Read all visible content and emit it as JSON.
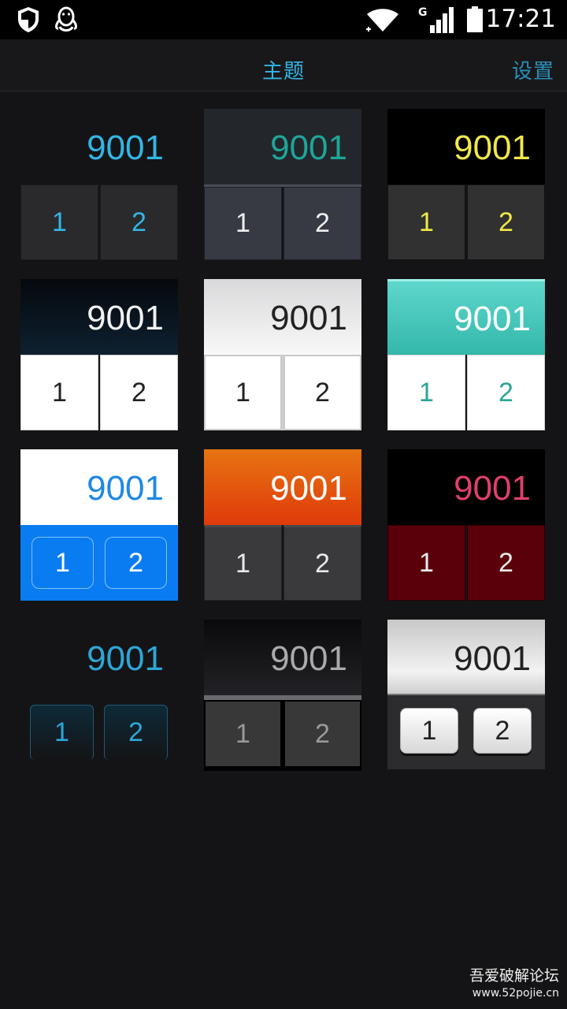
{
  "status_bar": {
    "time": "17:21",
    "network_type": "G",
    "icons": [
      "shield-icon",
      "qq-penguin-icon",
      "wifi-icon",
      "signal-icon",
      "battery-icon"
    ]
  },
  "header": {
    "title": "主题",
    "settings_label": "设置"
  },
  "themes": [
    {
      "display": "9001",
      "key1": "1",
      "key2": "2"
    },
    {
      "display": "9001",
      "key1": "1",
      "key2": "2"
    },
    {
      "display": "9001",
      "key1": "1",
      "key2": "2"
    },
    {
      "display": "9001",
      "key1": "1",
      "key2": "2"
    },
    {
      "display": "9001",
      "key1": "1",
      "key2": "2"
    },
    {
      "display": "9001",
      "key1": "1",
      "key2": "2"
    },
    {
      "display": "9001",
      "key1": "1",
      "key2": "2"
    },
    {
      "display": "9001",
      "key1": "1",
      "key2": "2"
    },
    {
      "display": "9001",
      "key1": "1",
      "key2": "2"
    },
    {
      "display": "9001",
      "key1": "1",
      "key2": "2"
    },
    {
      "display": "9001",
      "key1": "1",
      "key2": "2"
    },
    {
      "display": "9001",
      "key1": "1",
      "key2": "2"
    }
  ],
  "watermark": {
    "line1": "吾爱破解论坛",
    "line2": "www.52pojie.cn"
  },
  "colors": {
    "accent": "#33b5e5",
    "background": "#141416"
  }
}
